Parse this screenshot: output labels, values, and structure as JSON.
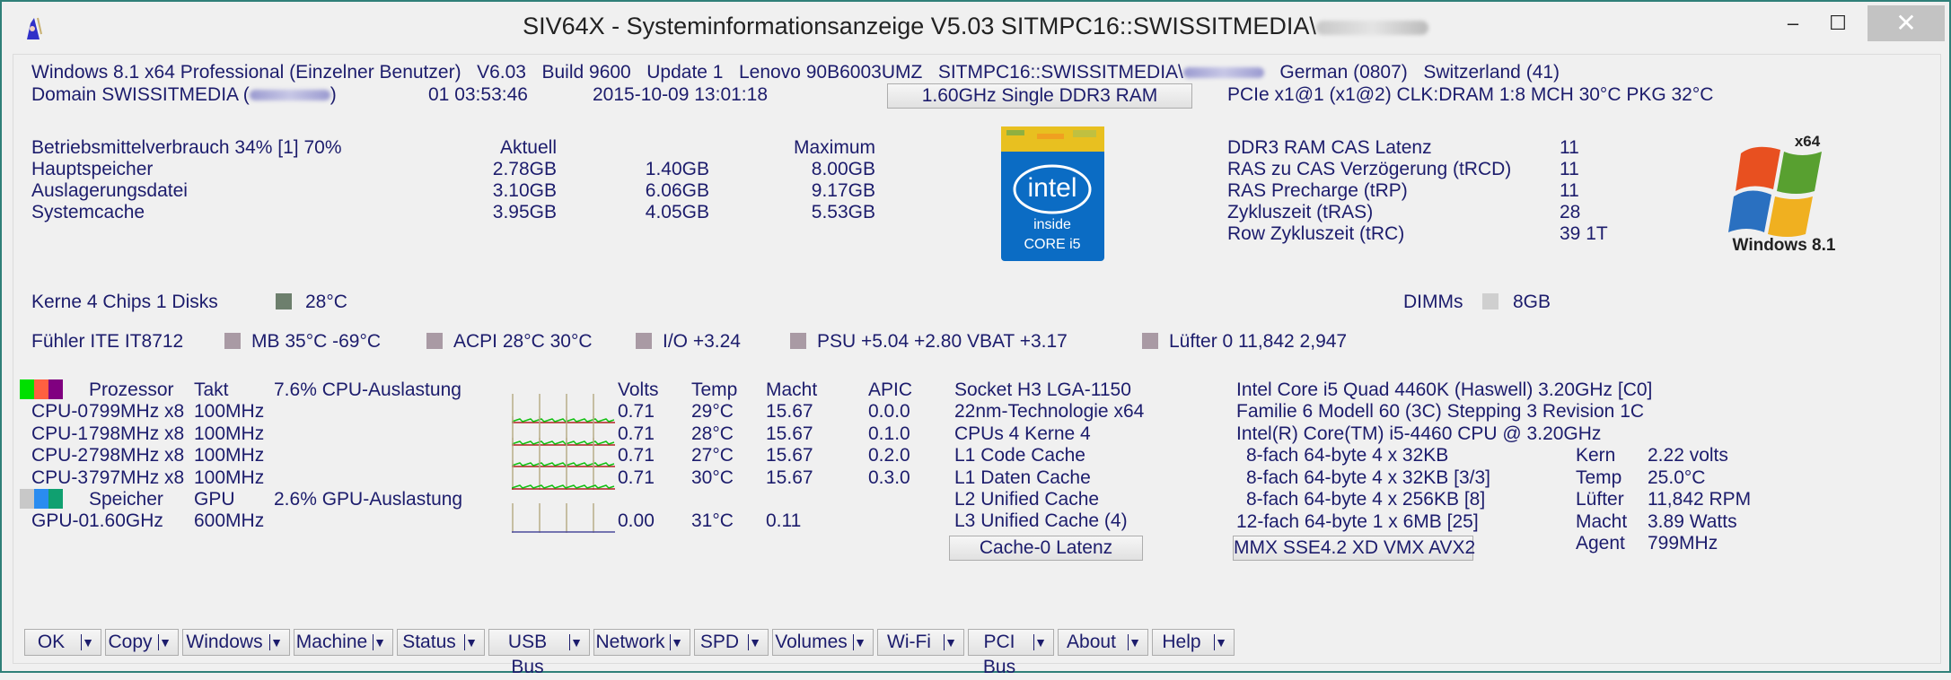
{
  "window": {
    "title": "SIV64X - Systeminformationsanzeige V5.03 SITMPC16::SWISSITMEDIA\\",
    "controls": {
      "minimize": "‒",
      "maximize": "☐",
      "close": "✕"
    }
  },
  "header": {
    "os": "Windows 8.1 x64 Professional (Einzelner Benutzer)",
    "version": "V6.03",
    "build": "Build 9600",
    "update": "Update 1",
    "machine": "Lenovo 90B6003UMZ",
    "user": "SITMPC16::SWISSITMEDIA\\",
    "language": "German (0807)",
    "country": "Switzerland (41)",
    "domain_prefix": "Domain SWISSITMEDIA (",
    "domain_suffix": ")",
    "uptime": "01 03:53:46",
    "datetime": "2015-10-09 13:01:18",
    "ram_button": "1.60GHz Single DDR3 RAM",
    "bus_info": "PCIe x1@1 (x1@2) CLK:DRAM 1:8  MCH 30°C  PKG 32°C"
  },
  "memory": {
    "title": "Betriebsmittelverbrauch 34% [1] 70%",
    "col_current": "Aktuell",
    "col_max": "Maximum",
    "rows": [
      {
        "label": "Hauptspeicher",
        "current": "2.78GB",
        "free": "1.40GB",
        "max": "8.00GB"
      },
      {
        "label": "Auslagerungsdatei",
        "current": "3.10GB",
        "free": "6.06GB",
        "max": "9.17GB"
      },
      {
        "label": "Systemcache",
        "current": "3.95GB",
        "free": "4.05GB",
        "max": "5.53GB"
      }
    ]
  },
  "timings": [
    {
      "label": "DDR3 RAM CAS Latenz",
      "value": "11"
    },
    {
      "label": "RAS zu CAS Verzögerung (tRCD)",
      "value": "11"
    },
    {
      "label": "RAS Precharge (tRP)",
      "value": "11"
    },
    {
      "label": "Zykluszeit (tRAS)",
      "value": "28"
    },
    {
      "label": "Row Zykluszeit (tRC)",
      "value": "39 1T"
    }
  ],
  "logos": {
    "intel": {
      "brand": "intel",
      "inside": "inside",
      "model": "CORE i5",
      "color": "#0b6cc4"
    },
    "windows": {
      "arch": "x64",
      "name": "Windows 8.1"
    }
  },
  "cores_line": "Kerne 4 Chips 1   Disks",
  "disk_temp": "28°C",
  "dimms_label": "DIMMs",
  "dimms_value": "8GB",
  "sensors": {
    "chip": "Fühler ITE IT8712",
    "items": [
      "MB 35°C -69°C",
      "ACPI 28°C 30°C",
      "I/O +3.24",
      "PSU +5.04 +2.80 VBAT +3.17",
      "Lüfter 0 11,842 2,947"
    ],
    "swatch_color": "#a99aa4"
  },
  "cpu_table": {
    "headers": {
      "name": "Prozessor",
      "clock": "Takt",
      "load": "7.6% CPU-Auslastung",
      "volts": "Volts",
      "temp": "Temp",
      "power": "Macht",
      "apic": "APIC"
    },
    "legend_colors": [
      "#00e000",
      "#ff6040",
      "#800080"
    ],
    "rows": [
      {
        "name": "CPU-0",
        "freq": "799MHz x8",
        "bus": "100MHz",
        "volts": "0.71",
        "temp": "29°C",
        "power": "15.67",
        "apic": "0.0.0"
      },
      {
        "name": "CPU-1",
        "freq": "798MHz x8",
        "bus": "100MHz",
        "volts": "0.71",
        "temp": "28°C",
        "power": "15.67",
        "apic": "0.1.0"
      },
      {
        "name": "CPU-2",
        "freq": "798MHz x8",
        "bus": "100MHz",
        "volts": "0.71",
        "temp": "27°C",
        "power": "15.67",
        "apic": "0.2.0"
      },
      {
        "name": "CPU-3",
        "freq": "797MHz x8",
        "bus": "100MHz",
        "volts": "0.71",
        "temp": "30°C",
        "power": "15.67",
        "apic": "0.3.0"
      }
    ],
    "gpu_headers": {
      "name": "Speicher",
      "clock": "GPU",
      "load": "2.6% GPU-Auslastung"
    },
    "gpu_legend_colors": [
      "#c8c8c8",
      "#2a8cf0",
      "#10a070"
    ],
    "gpu_row": {
      "name": "GPU-0",
      "freq": "1.60GHz",
      "bus": "600MHz",
      "volts": "0.00",
      "temp": "31°C",
      "power": "0.11"
    }
  },
  "cpu_info": {
    "socket": "Socket H3 LGA-1150",
    "tech": "22nm-Technologie  x64",
    "cores": "CPUs 4 Kerne 4",
    "l1c": "L1 Code Cache",
    "l1d": "L1 Daten Cache",
    "l2": "L2 Unified Cache",
    "l3": "L3 Unified Cache (4)",
    "cache_button": "Cache-0 Latenz",
    "model": "Intel Core i5 Quad 4460K (Haswell) 3.20GHz [C0]",
    "family": "Familie 6  Modell 60 (3C)  Stepping 3  Revision 1C",
    "brand": "Intel(R) Core(TM) i5-4460 CPU @ 3.20GHz",
    "caches": [
      "8-fach 64-byte  4 x 32KB",
      "8-fach 64-byte  4 x 32KB [3/3]",
      "8-fach 64-byte  4 x 256KB [8]",
      "12-fach 64-byte  1 x 6MB  [25]"
    ],
    "features_button": "MMX SSE4.2 XD VMX AVX2",
    "stats": [
      {
        "label": "Kern",
        "value": "2.22 volts"
      },
      {
        "label": "Temp",
        "value": "25.0°C"
      },
      {
        "label": "Lüfter",
        "value": "11,842 RPM"
      },
      {
        "label": "Macht",
        "value": "3.89 Watts"
      },
      {
        "label": "Agent",
        "value": "799MHz"
      }
    ]
  },
  "toolbar": [
    "OK",
    "Copy",
    "Windows",
    "Machine",
    "Status",
    "USB Bus",
    "Network",
    "SPD",
    "Volumes",
    "Wi-Fi",
    "PCI Bus",
    "About",
    "Help"
  ]
}
